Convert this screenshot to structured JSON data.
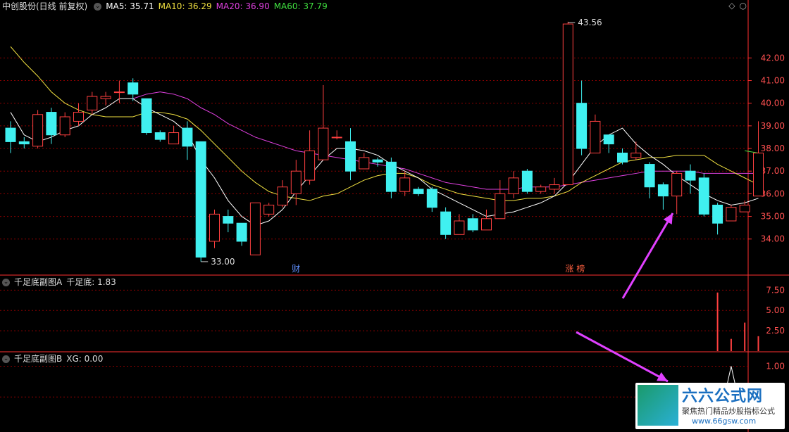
{
  "header": {
    "stock": "中创股份(日线 前复权)",
    "ma": [
      {
        "label": "MA5: 35.71",
        "color": "#ffffff"
      },
      {
        "label": "MA10: 36.29",
        "color": "#f0e040"
      },
      {
        "label": "MA20: 36.90",
        "color": "#e040e0"
      },
      {
        "label": "MA60: 37.79",
        "color": "#40e040"
      }
    ]
  },
  "sub_a": {
    "title": "千足底副图A",
    "value_label": "千足底: 1.83"
  },
  "sub_b": {
    "title": "千足底副图B",
    "value_label": "XG: 0.00"
  },
  "annotations": {
    "high": "43.56",
    "low": "33.00",
    "tag_cai": "财",
    "tag_zhang": "涨 榜"
  },
  "logo": {
    "title": "六六公式网",
    "subtitle": "聚焦热门精品炒股指标公式",
    "url": "www.66gsw.com"
  },
  "colors": {
    "up": "#ff4040",
    "down": "#40f0f0",
    "grid": "#8b0000",
    "axis": "#ff3030"
  },
  "chart_data": {
    "type": "candlestick",
    "y_ticks": [
      34,
      35,
      36,
      37,
      38,
      39,
      40,
      41,
      42
    ],
    "y_tick_labels": [
      "34.00",
      "35.00",
      "36.00",
      "37.00",
      "38.00",
      "39.00",
      "40.00",
      "41.00",
      "42.00"
    ],
    "ylim": [
      32.5,
      44.0
    ],
    "candles": [
      [
        38.9,
        38.3,
        39.2,
        37.8
      ],
      [
        38.3,
        38.2,
        38.5,
        38.0
      ],
      [
        38.1,
        39.5,
        39.7,
        38.0
      ],
      [
        39.6,
        38.6,
        39.8,
        38.2
      ],
      [
        38.6,
        39.4,
        39.6,
        38.5
      ],
      [
        39.2,
        39.6,
        40.0,
        39.0
      ],
      [
        39.7,
        40.3,
        40.5,
        39.5
      ],
      [
        40.2,
        40.3,
        40.5,
        39.9
      ],
      [
        40.5,
        40.5,
        41.0,
        40.0
      ],
      [
        40.9,
        40.4,
        41.1,
        40.1
      ],
      [
        40.2,
        38.7,
        40.2,
        38.6
      ],
      [
        38.7,
        38.4,
        38.8,
        38.3
      ],
      [
        38.2,
        38.7,
        39.0,
        38.2
      ],
      [
        38.9,
        38.1,
        39.2,
        37.5
      ],
      [
        38.3,
        33.2,
        38.3,
        33.0
      ],
      [
        33.9,
        35.1,
        35.3,
        33.6
      ],
      [
        35.0,
        34.7,
        35.3,
        34.3
      ],
      [
        34.7,
        33.9,
        34.7,
        33.7
      ],
      [
        33.3,
        35.6,
        35.6,
        33.3
      ],
      [
        35.1,
        35.5,
        35.6,
        35.0
      ],
      [
        35.5,
        36.3,
        36.6,
        35.4
      ],
      [
        36.0,
        37.0,
        37.5,
        35.5
      ],
      [
        36.6,
        37.9,
        38.8,
        36.4
      ],
      [
        37.5,
        38.9,
        40.8,
        37.5
      ],
      [
        38.5,
        38.5,
        38.8,
        38.4
      ],
      [
        38.3,
        37.0,
        38.9,
        36.6
      ],
      [
        37.1,
        37.6,
        37.8,
        37.1
      ],
      [
        37.5,
        37.4,
        37.6,
        37.2
      ],
      [
        37.4,
        36.1,
        37.6,
        35.8
      ],
      [
        36.1,
        36.7,
        37.0,
        35.9
      ],
      [
        36.2,
        36.0,
        36.3,
        35.9
      ],
      [
        36.2,
        35.4,
        36.3,
        35.2
      ],
      [
        35.2,
        34.2,
        35.4,
        34.0
      ],
      [
        34.2,
        34.8,
        35.1,
        34.2
      ],
      [
        34.9,
        34.4,
        35.1,
        34.3
      ],
      [
        34.4,
        34.9,
        35.3,
        34.4
      ],
      [
        34.9,
        36.0,
        36.6,
        34.9
      ],
      [
        36.0,
        36.7,
        37.0,
        35.8
      ],
      [
        37.0,
        36.1,
        37.1,
        36.0
      ],
      [
        36.1,
        36.3,
        36.4,
        36.0
      ],
      [
        36.2,
        36.4,
        36.7,
        36.0
      ],
      [
        36.4,
        43.5,
        43.6,
        36.4
      ],
      [
        40.0,
        38.0,
        41.0,
        37.7
      ],
      [
        37.8,
        39.2,
        39.5,
        37.8
      ],
      [
        38.6,
        38.2,
        38.6,
        37.8
      ],
      [
        37.8,
        37.4,
        38.0,
        37.3
      ],
      [
        37.6,
        37.8,
        38.3,
        37.5
      ],
      [
        37.3,
        36.3,
        37.4,
        35.8
      ],
      [
        36.4,
        35.9,
        36.5,
        35.3
      ],
      [
        35.9,
        36.9,
        37.0,
        35.1
      ],
      [
        37.0,
        36.6,
        37.3,
        36.0
      ],
      [
        36.7,
        35.1,
        36.9,
        35.0
      ],
      [
        35.5,
        34.7,
        35.6,
        34.2
      ],
      [
        34.8,
        35.4,
        35.5,
        34.8
      ],
      [
        35.2,
        35.5,
        35.7,
        35.2
      ],
      [
        35.9,
        37.8,
        39.2,
        35.9
      ]
    ],
    "ma5": [
      39.6,
      38.6,
      38.3,
      38.5,
      38.8,
      39.0,
      39.5,
      39.8,
      40.2,
      40.2,
      39.8,
      39.5,
      39.2,
      38.7,
      37.5,
      36.7,
      35.7,
      35.0,
      34.6,
      34.8,
      35.3,
      36.1,
      36.8,
      37.5,
      38.0,
      38.0,
      37.9,
      37.7,
      37.3,
      37.0,
      36.7,
      36.2,
      35.9,
      35.6,
      35.3,
      35.0,
      35.1,
      35.2,
      35.4,
      35.6,
      35.9,
      36.5,
      37.3,
      38.1,
      38.6,
      38.9,
      38.2,
      37.7,
      37.3,
      36.8,
      36.4,
      36.0,
      35.7,
      35.5,
      35.6,
      35.8
    ],
    "ma10": [
      42.5,
      41.8,
      41.2,
      40.5,
      40.0,
      39.7,
      39.5,
      39.4,
      39.4,
      39.4,
      39.6,
      39.6,
      39.5,
      39.3,
      38.8,
      38.2,
      37.6,
      37.0,
      36.5,
      36.1,
      35.9,
      35.8,
      35.7,
      35.9,
      36.0,
      36.3,
      36.6,
      36.8,
      36.9,
      36.9,
      36.7,
      36.4,
      36.2,
      36.0,
      35.9,
      35.8,
      35.7,
      35.7,
      35.8,
      35.8,
      35.9,
      36.1,
      36.5,
      36.8,
      37.1,
      37.4,
      37.5,
      37.6,
      37.6,
      37.7,
      37.7,
      37.7,
      37.3,
      37.0,
      36.7,
      36.4
    ],
    "ma20": [
      null,
      null,
      null,
      null,
      null,
      null,
      null,
      null,
      null,
      40.2,
      40.4,
      40.5,
      40.4,
      40.2,
      39.8,
      39.5,
      39.1,
      38.8,
      38.5,
      38.3,
      38.1,
      37.9,
      37.8,
      37.7,
      37.6,
      37.5,
      37.4,
      37.3,
      37.2,
      37.1,
      36.9,
      36.7,
      36.5,
      36.4,
      36.3,
      36.2,
      36.2,
      36.2,
      36.3,
      36.3,
      36.3,
      36.4,
      36.5,
      36.6,
      36.7,
      36.8,
      36.9,
      37.0,
      37.0,
      37.0,
      37.0,
      36.9,
      36.9,
      36.9,
      36.9,
      36.9
    ],
    "ma60": [
      null,
      null,
      null,
      null,
      null,
      null,
      null,
      null,
      null,
      null,
      null,
      null,
      null,
      null,
      null,
      null,
      null,
      null,
      null,
      null,
      null,
      null,
      null,
      null,
      null,
      null,
      null,
      null,
      null,
      null,
      null,
      null,
      null,
      null,
      null,
      null,
      null,
      null,
      null,
      null,
      null,
      null,
      null,
      null,
      null,
      null,
      null,
      null,
      null,
      null,
      null,
      null,
      null,
      null,
      37.9,
      37.8
    ],
    "sub_a": {
      "y_ticks": [
        2.5,
        5.0,
        7.5
      ],
      "y_tick_labels": [
        "2.50",
        "5.00",
        "7.50"
      ],
      "ylim": [
        0,
        9.0
      ],
      "bars": [
        {
          "index": 52,
          "value": 7.2
        },
        {
          "index": 53,
          "value": 1.5
        },
        {
          "index": 54,
          "value": 3.5
        },
        {
          "index": 55,
          "value": 1.83
        }
      ]
    },
    "sub_b": {
      "y_ticks": [
        0.5,
        1.0
      ],
      "y_tick_labels": [
        "0.50",
        "1.00"
      ],
      "ylim": [
        0,
        1.2
      ],
      "line": [
        {
          "index": 52,
          "value": 0
        },
        {
          "index": 53,
          "value": 1.0
        },
        {
          "index": 54,
          "value": 0
        }
      ]
    }
  }
}
